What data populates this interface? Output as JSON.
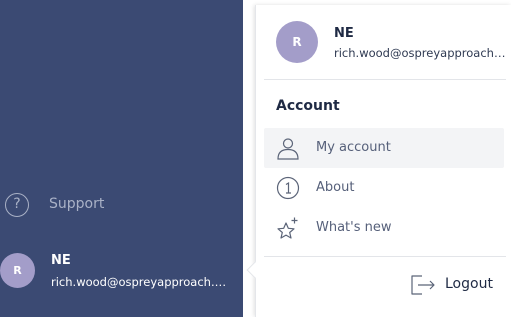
{
  "sidebar": {
    "support_label": "Support",
    "user": {
      "avatar_letter": "R",
      "initials": "NE",
      "email": "rich.wood@ospreyapproach.c..."
    }
  },
  "panel": {
    "avatar_letter": "R",
    "initials": "NE",
    "email": "rich.wood@ospreyapproach....",
    "section_heading": "Account",
    "items": [
      {
        "label": "My account",
        "icon": "user-icon",
        "active": true
      },
      {
        "label": "About",
        "icon": "info-icon",
        "active": false
      },
      {
        "label": "What's new",
        "icon": "sparkle-star-icon",
        "active": false
      }
    ],
    "logout_label": "Logout"
  },
  "colors": {
    "sidebar_bg": "#3b4a73",
    "avatar_bg": "#a39dc9",
    "active_item_bg": "#f3f4f6"
  }
}
